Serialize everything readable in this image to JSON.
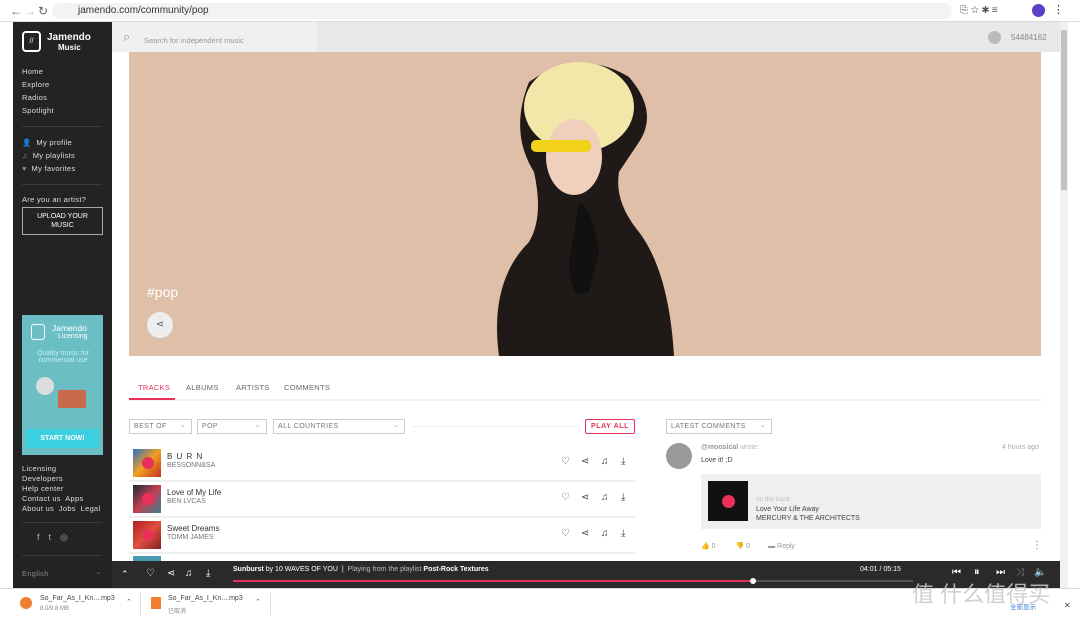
{
  "browser": {
    "url": "jamendo.com/community/pop"
  },
  "brand": {
    "name": "Jamendo",
    "sub": "Music"
  },
  "sidebar": {
    "nav": [
      "Home",
      "Explore",
      "Radios",
      "Spotlight"
    ],
    "user_items": [
      {
        "label": "My profile",
        "icon": "user-icon"
      },
      {
        "label": "My playlists",
        "icon": "playlist-icon"
      },
      {
        "label": "My favorites",
        "icon": "heart-icon"
      }
    ],
    "artist_prompt": "Are you an artist?",
    "upload_label": "UPLOAD YOUR MUSIC",
    "ad": {
      "brand": "Jamendo",
      "sub": "Licensing",
      "tagline": "Quality music for commercial use",
      "cta": "START NOW!",
      "color": "#6bbfc4"
    },
    "footer_links": [
      "Licensing",
      "Developers",
      "Help center",
      "Contact us",
      "Apps",
      "About us",
      "Jobs",
      "Legal"
    ],
    "language": "English"
  },
  "topbar": {
    "search_placeholder": "Search for independent music",
    "user_id": "54484162"
  },
  "hero": {
    "title": "#pop"
  },
  "tabs": [
    {
      "label": "TRACKS",
      "active": true
    },
    {
      "label": "ALBUMS"
    },
    {
      "label": "ARTISTS"
    },
    {
      "label": "COMMENTS"
    }
  ],
  "filters": {
    "period": "BEST OF",
    "genre": "POP",
    "country": "ALL COUNTRIES",
    "play_all": "PLAY ALL",
    "comments_sort": "LATEST COMMENTS"
  },
  "tracks": [
    {
      "title": "B U R N",
      "artist": "BESSONN&SA"
    },
    {
      "title": "Love of My Life",
      "artist": "BEN LVCAS"
    },
    {
      "title": "Sweet Dreams",
      "artist": "TOMM JAMES"
    }
  ],
  "comment": {
    "user": "@moosical",
    "wrote": "wrote:",
    "time": "4 hours ago",
    "text": "Love it! ;D",
    "on_track": "on the track:",
    "track_title": "Love Your Life Away",
    "track_artist": "MERCURY & THE ARCHITECTS",
    "likes": "0",
    "dislikes": "0",
    "reply": "Reply"
  },
  "player": {
    "track": "Sunburst",
    "by": "by",
    "artist": "10 WAVES OF YOU",
    "playing_from": "Playing from the playlist",
    "playlist": "Post-Rock Textures",
    "time": "04:01 / 05:15",
    "progress": 0.765
  },
  "downloads": [
    {
      "name": "So_Far_As_I_Kn....mp3",
      "status": "8.0/9.8 MB"
    },
    {
      "name": "So_Far_As_I_Kn....mp3",
      "status": "已取消"
    }
  ],
  "watermark": "值 什么值得买",
  "show_all": "全部显示",
  "accent": "#e8305a"
}
